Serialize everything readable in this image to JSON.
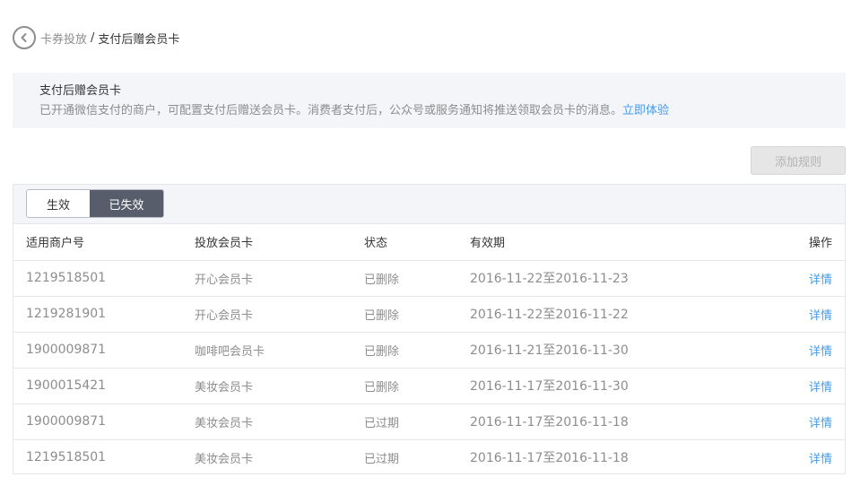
{
  "breadcrumb": {
    "parent": "卡券投放",
    "separator": "/",
    "current": "支付后赠会员卡"
  },
  "info": {
    "title": "支付后赠会员卡",
    "description": "已开通微信支付的商户，可配置支付后赠送会员卡。消费者支付后，公众号或服务通知将推送领取会员卡的消息。",
    "link": "立即体验"
  },
  "toolbar": {
    "add_rule_label": "添加规则"
  },
  "tabs": [
    {
      "label": "生效",
      "active": false
    },
    {
      "label": "已失效",
      "active": true
    }
  ],
  "table": {
    "headers": [
      "适用商户号",
      "投放会员卡",
      "状态",
      "有效期",
      "操作"
    ],
    "rows": [
      {
        "merchant": "1219518501",
        "card": "开心会员卡",
        "status": "已删除",
        "period": "2016-11-22至2016-11-23",
        "action": "详情"
      },
      {
        "merchant": "1219281901",
        "card": "开心会员卡",
        "status": "已删除",
        "period": "2016-11-22至2016-11-22",
        "action": "详情"
      },
      {
        "merchant": "1900009871",
        "card": "咖啡吧会员卡",
        "status": "已删除",
        "period": "2016-11-21至2016-11-30",
        "action": "详情"
      },
      {
        "merchant": "1900015421",
        "card": "美妆会员卡",
        "status": "已删除",
        "period": "2016-11-17至2016-11-30",
        "action": "详情"
      },
      {
        "merchant": "1900009871",
        "card": "美妆会员卡",
        "status": "已过期",
        "period": "2016-11-17至2016-11-18",
        "action": "详情"
      },
      {
        "merchant": "1219518501",
        "card": "美妆会员卡",
        "status": "已过期",
        "period": "2016-11-17至2016-11-18",
        "action": "详情"
      }
    ]
  },
  "colors": {
    "accent_link": "#459ae9",
    "active_tab_bg": "#575d6b",
    "info_bg": "#f4f5f9"
  },
  "icons": {
    "back": "chevron-left-icon"
  }
}
